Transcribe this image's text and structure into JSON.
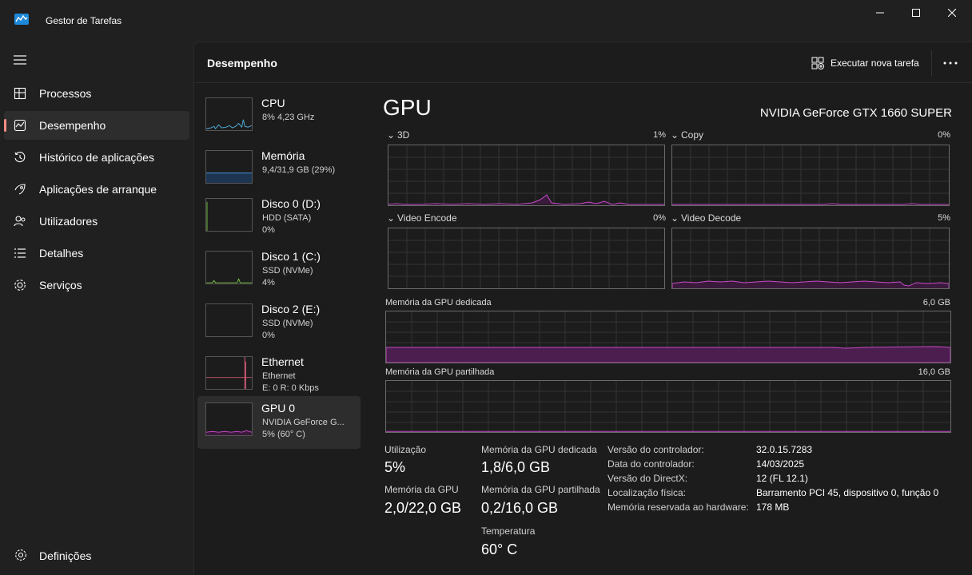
{
  "window": {
    "title": "Gestor de Tarefas"
  },
  "nav": {
    "items": [
      {
        "label": "Processos",
        "icon": "processes-icon"
      },
      {
        "label": "Desempenho",
        "icon": "performance-icon",
        "active": true
      },
      {
        "label": "Histórico de aplicações",
        "icon": "history-icon"
      },
      {
        "label": "Aplicações de arranque",
        "icon": "startup-icon"
      },
      {
        "label": "Utilizadores",
        "icon": "users-icon"
      },
      {
        "label": "Detalhes",
        "icon": "details-icon"
      },
      {
        "label": "Serviços",
        "icon": "services-icon"
      }
    ],
    "settings_label": "Definições"
  },
  "header": {
    "title": "Desempenho",
    "run_task_label": "Executar nova tarefa"
  },
  "resources": [
    {
      "name": "CPU",
      "line1": "8% 4,23 GHz",
      "line2": "",
      "color": "#4fa9d9"
    },
    {
      "name": "Memória",
      "line1": "9,4/31,9 GB (29%)",
      "line2": "",
      "color": "#4a8fd8"
    },
    {
      "name": "Disco 0 (D:)",
      "line1": "HDD (SATA)",
      "line2": "0%",
      "color": "#74c043"
    },
    {
      "name": "Disco 1 (C:)",
      "line1": "SSD (NVMe)",
      "line2": "4%",
      "color": "#74c043"
    },
    {
      "name": "Disco 2 (E:)",
      "line1": "SSD (NVMe)",
      "line2": "0%",
      "color": "#74c043"
    },
    {
      "name": "Ethernet",
      "line1": "Ethernet",
      "line2": "E: 0 R: 0 Kbps",
      "color": "#e0607e"
    },
    {
      "name": "GPU 0",
      "line1": "NVIDIA GeForce G...",
      "line2": "5% (60° C)",
      "color": "#c54ac6",
      "selected": true
    }
  ],
  "gpu": {
    "title": "GPU",
    "model": "NVIDIA GeForce GTX 1660 SUPER",
    "engines": [
      {
        "label": "3D",
        "value": "1%"
      },
      {
        "label": "Copy",
        "value": "0%"
      },
      {
        "label": "Video Encode",
        "value": "0%"
      },
      {
        "label": "Video Decode",
        "value": "5%"
      }
    ],
    "dedicated_label": "Memória da GPU dedicada",
    "dedicated_max": "6,0 GB",
    "shared_label": "Memória da GPU partilhada",
    "shared_max": "16,0 GB",
    "accent": "#c54ac6"
  },
  "stats": {
    "utilization_label": "Utilização",
    "utilization": "5%",
    "gpu_memory_label": "Memória da GPU",
    "gpu_memory": "2,0/22,0 GB",
    "dedicated_label": "Memória da GPU dedicada",
    "dedicated": "1,8/6,0 GB",
    "shared_label": "Memória da GPU partilhada",
    "shared": "0,2/16,0 GB",
    "temp_label": "Temperatura",
    "temp": "60° C"
  },
  "info": [
    {
      "key": "Versão do controlador:",
      "value": "32.0.15.7283"
    },
    {
      "key": "Data do controlador:",
      "value": "14/03/2025"
    },
    {
      "key": "Versão do DirectX:",
      "value": "12 (FL 12.1)"
    },
    {
      "key": "Localização física:",
      "value": "Barramento PCI 45, dispositivo 0, função 0"
    },
    {
      "key": "Memória reservada ao hardware:",
      "value": "178 MB"
    }
  ]
}
